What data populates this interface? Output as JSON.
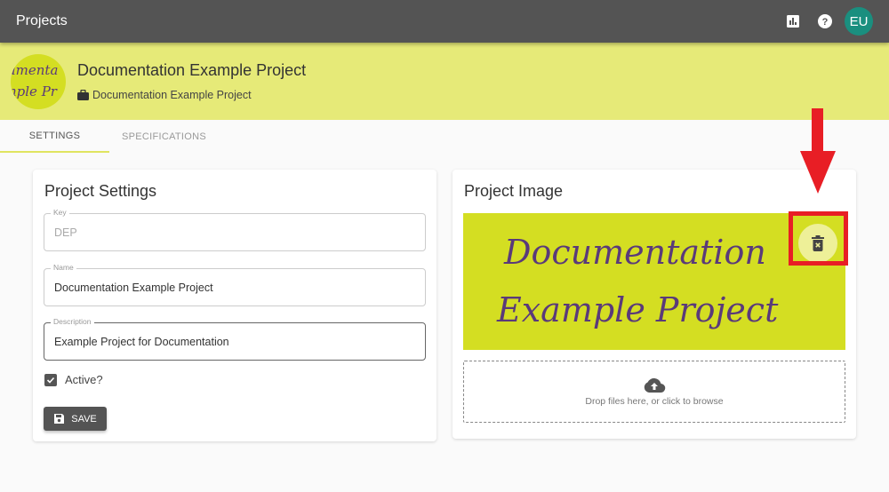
{
  "topbar": {
    "title": "Projects",
    "icons": [
      "chart-icon",
      "help-icon"
    ],
    "avatar_initials": "EU",
    "avatar_color": "#1a8f7f"
  },
  "header": {
    "logo_line1": "umenta",
    "logo_line2": "nple Pr",
    "project_title": "Documentation Example Project",
    "project_subtitle": "Documentation Example Project",
    "background_color": "#e6ea78"
  },
  "tabs": [
    {
      "label": "SETTINGS",
      "active": true
    },
    {
      "label": "SPECIFICATIONS",
      "active": false
    }
  ],
  "settings_card": {
    "title": "Project Settings",
    "fields": {
      "key": {
        "label": "Key",
        "value": "DEP",
        "disabled": true
      },
      "name": {
        "label": "Name",
        "value": "Documentation Example Project"
      },
      "description": {
        "label": "Description",
        "value": "Example Project for Documentation"
      }
    },
    "active_checkbox": {
      "label": "Active?",
      "checked": true
    },
    "save_label": "SAVE"
  },
  "image_card": {
    "title": "Project Image",
    "image_line1": "Documentation",
    "image_line2": "Example Project",
    "image_bg_color": "#d4de22",
    "image_text_color": "#5a3a7a",
    "delete_icon": "delete-forever-icon",
    "dropzone_text": "Drop files here, or click to browse"
  },
  "annotation": {
    "color": "#e81e25",
    "target": "delete-image-button"
  }
}
